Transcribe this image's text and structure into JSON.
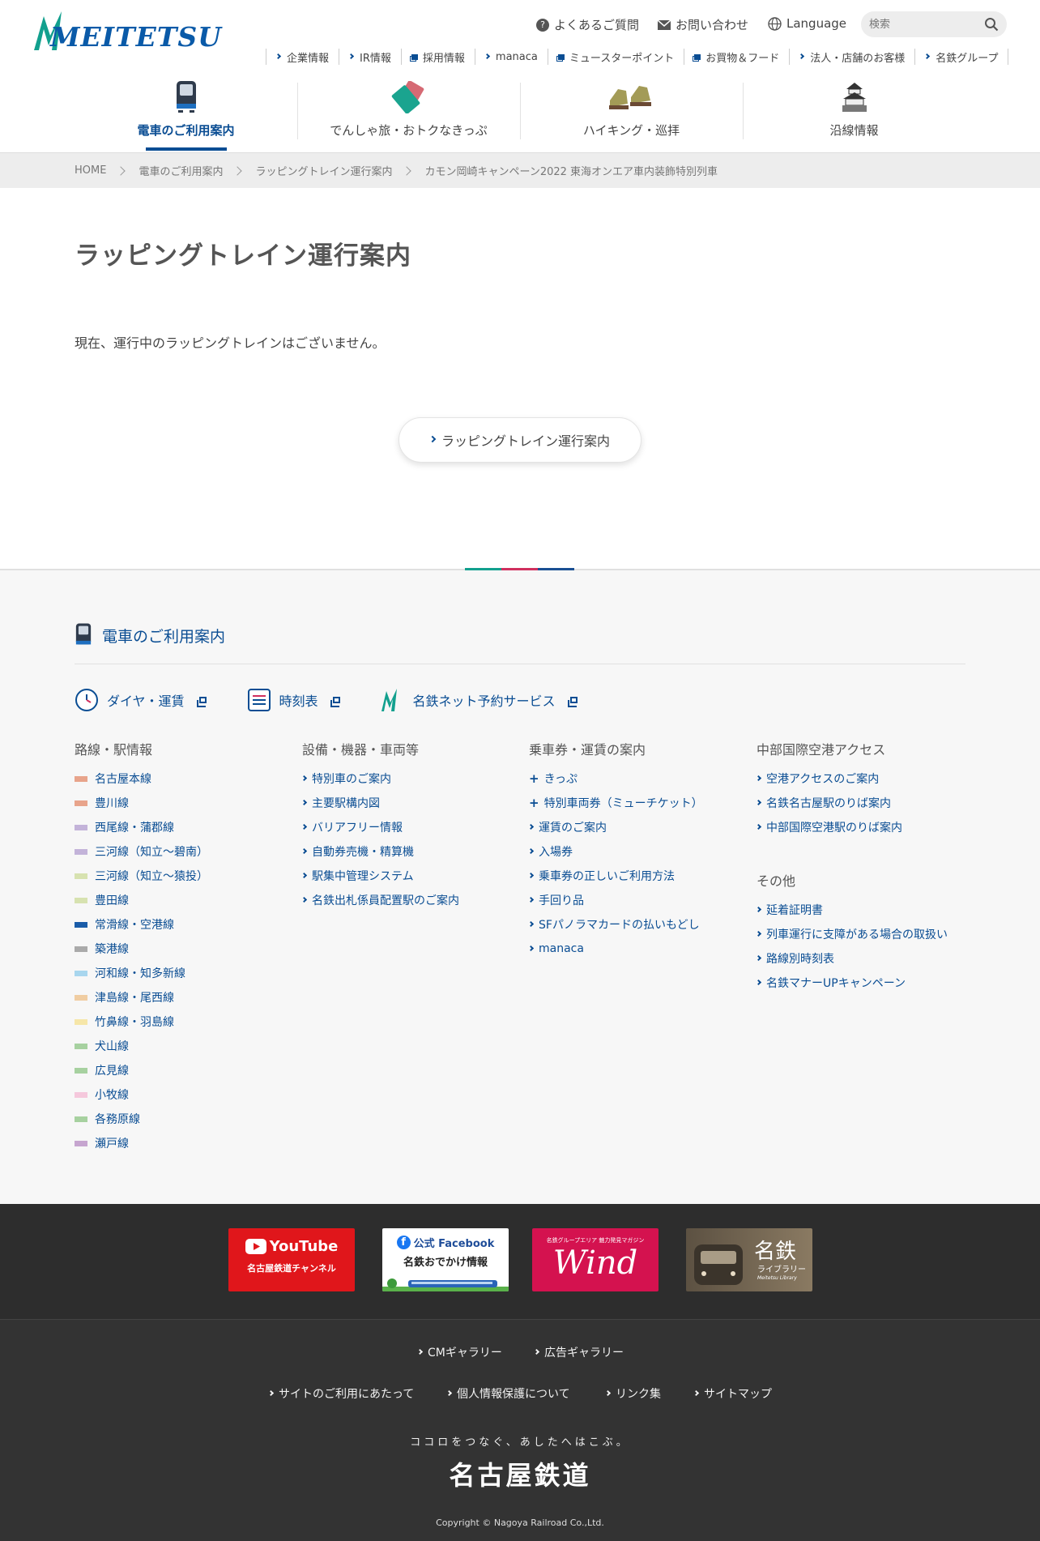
{
  "header": {
    "logo_text": "MEITETSU",
    "utility": {
      "faq": "よくあるご質問",
      "contact": "お問い合わせ",
      "language": "Language"
    },
    "search_placeholder": "検索",
    "subnav": [
      {
        "label": "企業情報",
        "icon": "chevron-right-icon"
      },
      {
        "label": "IR情報",
        "icon": "chevron-right-icon"
      },
      {
        "label": "採用情報",
        "icon": "external-link-icon"
      },
      {
        "label": "manaca",
        "icon": "chevron-right-icon"
      },
      {
        "label": "ミュースターポイント",
        "icon": "external-link-icon"
      },
      {
        "label": "お買物＆フード",
        "icon": "external-link-icon"
      },
      {
        "label": "法人・店舗のお客様",
        "icon": "chevron-right-icon"
      },
      {
        "label": "名鉄グループ",
        "icon": "chevron-right-icon"
      }
    ],
    "mainnav": [
      {
        "label": "電車のご利用案内",
        "icon": "train-icon",
        "active": true
      },
      {
        "label": "でんしゃ旅・おトクなきっぷ",
        "icon": "ticket-icon",
        "active": false
      },
      {
        "label": "ハイキング・巡拝",
        "icon": "hiking-boots-icon",
        "active": false
      },
      {
        "label": "沿線情報",
        "icon": "castle-icon",
        "active": false
      }
    ]
  },
  "breadcrumb": [
    "HOME",
    "電車のご利用案内",
    "ラッピングトレイン運行案内",
    "カモン岡崎キャンペーン2022 東海オンエア車内装飾特別列車"
  ],
  "main": {
    "title": "ラッピングトレイン運行案内",
    "notice": "現在、運行中のラッピングトレインはございません。",
    "button_label": "ラッピングトレイン運行案内"
  },
  "footer_nav": {
    "title": "電車のご利用案内",
    "quick_links": [
      {
        "label": "ダイヤ・運賃",
        "icon": "clock-icon"
      },
      {
        "label": "時刻表",
        "icon": "timetable-icon"
      },
      {
        "label": "名鉄ネット予約サービス",
        "icon": "meitetsu-mark-icon"
      }
    ],
    "lines": {
      "heading": "路線・駅情報",
      "items": [
        {
          "label": "名古屋本線",
          "color": "#e8a48b"
        },
        {
          "label": "豊川線",
          "color": "#e8a48b"
        },
        {
          "label": "西尾線・蒲郡線",
          "color": "#c3b3d9"
        },
        {
          "label": "三河線（知立〜碧南）",
          "color": "#c3b3d9"
        },
        {
          "label": "三河線（知立〜猿投）",
          "color": "#d7e2b0"
        },
        {
          "label": "豊田線",
          "color": "#d7e2b0"
        },
        {
          "label": "常滑線・空港線",
          "color": "#1a5ca8"
        },
        {
          "label": "築港線",
          "color": "#aaaaaa"
        },
        {
          "label": "河和線・知多新線",
          "color": "#a8d6ee"
        },
        {
          "label": "津島線・尾西線",
          "color": "#f0cda2"
        },
        {
          "label": "竹鼻線・羽島線",
          "color": "#f6e6a8"
        },
        {
          "label": "犬山線",
          "color": "#a7d1a0"
        },
        {
          "label": "広見線",
          "color": "#a7d1a0"
        },
        {
          "label": "小牧線",
          "color": "#f5c8dc"
        },
        {
          "label": "各務原線",
          "color": "#a7d1a0"
        },
        {
          "label": "瀬戸線",
          "color": "#c6a5cf"
        }
      ]
    },
    "facilities": {
      "heading": "設備・機器・車両等",
      "items": [
        "特別車のご案内",
        "主要駅構内図",
        "バリアフリー情報",
        "自動券売機・精算機",
        "駅集中管理システム",
        "名鉄出札係員配置駅のご案内"
      ]
    },
    "tickets": {
      "heading": "乗車券・運賃の案内",
      "items": [
        {
          "label": "きっぷ",
          "icon": "plus-icon"
        },
        {
          "label": "特別車両券（ミューチケット）",
          "icon": "plus-icon"
        },
        {
          "label": "運賃のご案内",
          "icon": "chevron-right-icon"
        },
        {
          "label": "入場券",
          "icon": "chevron-right-icon"
        },
        {
          "label": "乗車券の正しいご利用方法",
          "icon": "chevron-right-icon"
        },
        {
          "label": "手回り品",
          "icon": "chevron-right-icon"
        },
        {
          "label": "SFパノラマカードの払いもどし",
          "icon": "chevron-right-icon"
        },
        {
          "label": "manaca",
          "icon": "chevron-right-icon"
        }
      ]
    },
    "airport": {
      "heading": "中部国際空港アクセス",
      "items": [
        "空港アクセスのご案内",
        "名鉄名古屋駅のりば案内",
        "中部国際空港駅のりば案内"
      ]
    },
    "other": {
      "heading": "その他",
      "items": [
        "延着証明書",
        "列車運行に支障がある場合の取扱い",
        "路線別時刻表",
        "名鉄マナーUPキャンペーン"
      ]
    }
  },
  "sns": {
    "youtube_logo": "YouTube",
    "youtube_label": "名古屋鉄道チャンネル",
    "facebook_top": "公式 Facebook",
    "facebook_bottom": "名鉄おでかけ情報",
    "wind_top": "名鉄グループエリア 魅力発見マガジン",
    "wind_title": "Wind",
    "library_title": "名鉄",
    "library_sub": "ライブラリー",
    "library_en": "Meitetsu Library"
  },
  "bottom": {
    "row1": [
      "CMギャラリー",
      "広告ギャラリー"
    ],
    "row2": [
      "サイトのご利用にあたって",
      "個人情報保護について",
      "リンク集",
      "サイトマップ"
    ],
    "tagline": "ココロをつなぐ、あしたへはこぶ。",
    "brand": "名古屋鉄道",
    "copyright": "Copyright © Nagoya Railroad Co.,Ltd."
  }
}
